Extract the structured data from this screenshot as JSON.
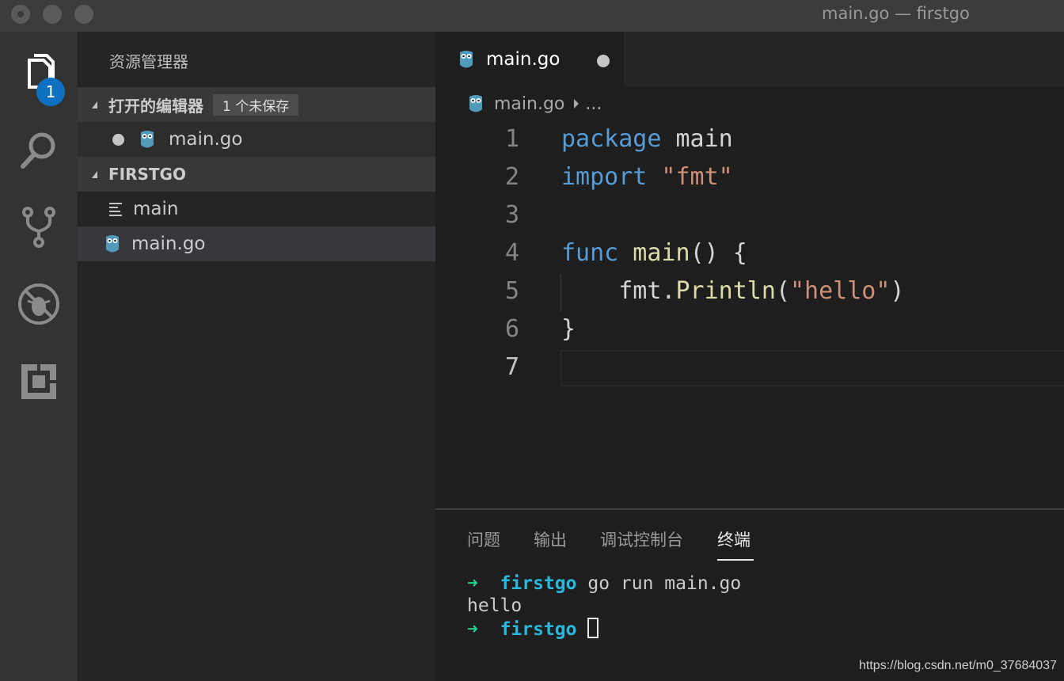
{
  "window": {
    "title": "main.go — firstgo"
  },
  "activity": {
    "badge_count": "1"
  },
  "sidebar": {
    "title": "资源管理器",
    "open_editors": {
      "label": "打开的编辑器",
      "unsaved_badge": "1 个未保存",
      "file": "main.go"
    },
    "folder": {
      "label": "FIRSTGO",
      "items": [
        "main",
        "main.go"
      ]
    }
  },
  "editor": {
    "tab": "main.go",
    "breadcrumb": {
      "file": "main.go",
      "more": "..."
    },
    "line_numbers": [
      "1",
      "2",
      "3",
      "4",
      "5",
      "6",
      "7"
    ],
    "code": {
      "l1_kw": "package",
      "l1_rest": " main",
      "l2_kw": "import",
      "l2_str": " \"fmt\"",
      "l4_kw": "func",
      "l4_fn": " main",
      "l4_rest": "() {",
      "l5_pre": "    fmt.",
      "l5_fn": "Println",
      "l5_open": "(",
      "l5_str": "\"hello\"",
      "l5_close": ")",
      "l6": "}"
    }
  },
  "panel": {
    "tabs": [
      "问题",
      "输出",
      "调试控制台",
      "终端"
    ],
    "terminal": {
      "arrow": "➜",
      "dir": "firstgo",
      "command": " go run main.go",
      "output": "hello"
    }
  },
  "watermark": "https://blog.csdn.net/m0_37684037",
  "colors": {
    "accent": "#0e70c0",
    "keyword": "#569cd6",
    "string": "#ce9178",
    "function": "#dcdcaa",
    "terminal_dir": "#29b8db",
    "terminal_arrow": "#23d18b"
  }
}
